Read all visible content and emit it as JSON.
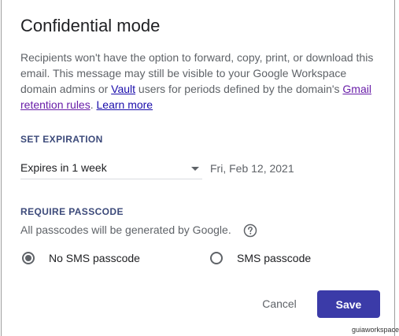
{
  "dialog": {
    "title": "Confidential mode",
    "description": {
      "text_part1": "Recipients won't have the option to forward, copy, print, or download this email. This message may still be visible to your Google Workspace domain admins or ",
      "vault_link": "Vault",
      "text_part2": " users for periods defined by the domain's ",
      "retention_link": "Gmail retention rules",
      "text_part3": ". ",
      "learn_more_link": "Learn more"
    },
    "expiration": {
      "heading": "SET EXPIRATION",
      "selected": "Expires in 1 week",
      "date": "Fri, Feb 12, 2021"
    },
    "passcode": {
      "heading": "REQUIRE PASSCODE",
      "note": "All passcodes will be generated by Google.",
      "options": [
        {
          "label": "No SMS passcode",
          "checked": true
        },
        {
          "label": "SMS passcode",
          "checked": false
        }
      ]
    },
    "actions": {
      "cancel_label": "Cancel",
      "save_label": "Save"
    }
  },
  "watermark": "guiaworkspace",
  "colors": {
    "primary_button": "#3b3ba8",
    "section_heading": "#3c4a7a",
    "link": "#1a0dab",
    "visited_link": "#681da8"
  },
  "icons": {
    "help": "help-circle-icon",
    "dropdown": "chevron-down-icon"
  }
}
